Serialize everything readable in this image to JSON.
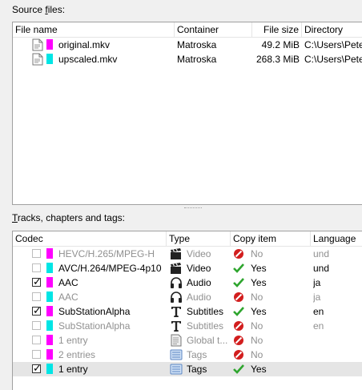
{
  "source_files": {
    "label_prefix": "Source ",
    "label_accel": "f",
    "label_suffix": "iles:",
    "columns": [
      "File name",
      "Container",
      "File size",
      "Directory"
    ],
    "rows": [
      {
        "name": "original.mkv",
        "container": "Matroska",
        "size": "49.2 MiB",
        "directory": "C:\\Users\\Pete",
        "color": "#ff00ff"
      },
      {
        "name": "upscaled.mkv",
        "container": "Matroska",
        "size": "268.3 MiB",
        "directory": "C:\\Users\\Pete",
        "color": "#00e5e5"
      }
    ]
  },
  "tracks": {
    "label_accel": "T",
    "label_rest": "racks, chapters and tags:",
    "columns": [
      "Codec",
      "Type",
      "Copy item",
      "Language"
    ],
    "rows": [
      {
        "codec": "HEVC/H.265/MPEG-H",
        "type": "Video",
        "copy": "No",
        "lang": "und",
        "checked": false,
        "color": "#ff00ff",
        "icon": "clapperboard-icon",
        "status_icon": "no-icon",
        "dim": true
      },
      {
        "codec": "AVC/H.264/MPEG-4p10",
        "type": "Video",
        "copy": "Yes",
        "lang": "und",
        "checked": false,
        "color": "#00e5e5",
        "icon": "clapperboard-icon",
        "status_icon": "check-icon",
        "dim": false
      },
      {
        "codec": "AAC",
        "type": "Audio",
        "copy": "Yes",
        "lang": "ja",
        "checked": true,
        "color": "#ff00ff",
        "icon": "headphones-icon",
        "status_icon": "check-icon",
        "dim": false
      },
      {
        "codec": "AAC",
        "type": "Audio",
        "copy": "No",
        "lang": "ja",
        "checked": false,
        "color": "#00e5e5",
        "icon": "headphones-icon",
        "status_icon": "no-icon",
        "dim": true
      },
      {
        "codec": "SubStationAlpha",
        "type": "Subtitles",
        "copy": "Yes",
        "lang": "en",
        "checked": true,
        "color": "#ff00ff",
        "icon": "text-icon",
        "status_icon": "check-icon",
        "dim": false
      },
      {
        "codec": "SubStationAlpha",
        "type": "Subtitles",
        "copy": "No",
        "lang": "en",
        "checked": false,
        "color": "#00e5e5",
        "icon": "text-icon",
        "status_icon": "no-icon",
        "dim": true
      },
      {
        "codec": "1 entry",
        "type": "Global t...",
        "copy": "No",
        "lang": "",
        "checked": false,
        "color": "#ff00ff",
        "icon": "document-icon",
        "status_icon": "no-icon",
        "dim": true
      },
      {
        "codec": "2 entries",
        "type": "Tags",
        "copy": "No",
        "lang": "",
        "checked": false,
        "color": "#ff00ff",
        "icon": "tags-icon",
        "status_icon": "no-icon",
        "dim": true
      },
      {
        "codec": "1 entry",
        "type": "Tags",
        "copy": "Yes",
        "lang": "",
        "checked": true,
        "color": "#00e5e5",
        "icon": "tags-icon",
        "status_icon": "check-icon",
        "dim": false,
        "selected": true
      }
    ]
  }
}
